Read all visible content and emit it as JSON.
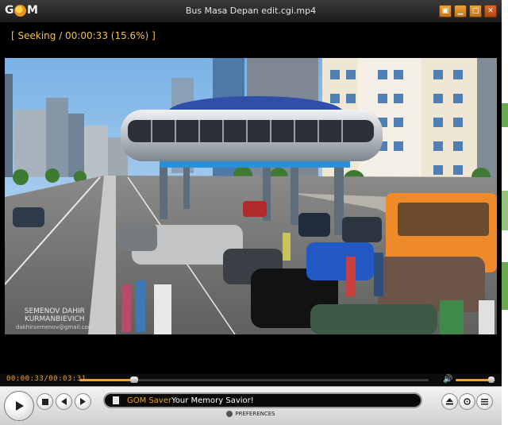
{
  "app": {
    "logo_parts": [
      "G",
      "M"
    ],
    "window_title": "Bus Masa Depan edit.cgi.mp4",
    "window_buttons": [
      {
        "name": "skin-icon",
        "glyph": "▣"
      },
      {
        "name": "minimize-icon",
        "glyph": "▁"
      },
      {
        "name": "maximize-icon",
        "glyph": "□"
      },
      {
        "name": "close-icon",
        "glyph": "✕"
      }
    ]
  },
  "osd": {
    "text": "[ Seeking / 00:00:33 (15.6%) ]",
    "color": "#f0c050"
  },
  "video": {
    "watermark_line1": "SEMENOV  DAHIR",
    "watermark_line2": "KURMANBIEVICH",
    "watermark_line3": "dakhirsemenov@gmail.com"
  },
  "seek": {
    "time_display": "00:00:33/00:03:31",
    "progress": 0.156,
    "volume": 0.9
  },
  "controls": {
    "buttons": [
      {
        "name": "play-button",
        "glyph": "▶"
      },
      {
        "name": "stop-button",
        "glyph": "■"
      },
      {
        "name": "previous-button",
        "glyph": "◀"
      },
      {
        "name": "next-button",
        "glyph": "▶"
      }
    ],
    "panel_brand": "GOM Saver",
    "panel_slogan": "Your Memory Savior!",
    "right_buttons": [
      {
        "name": "open-file-button",
        "glyph": "⏏"
      },
      {
        "name": "settings-button",
        "glyph": "✥"
      },
      {
        "name": "playlist-button",
        "glyph": "≡"
      }
    ],
    "preferences_label": "PREFERENCES"
  },
  "colors": {
    "accent": "#f0a030",
    "player_bg": "#000000"
  }
}
